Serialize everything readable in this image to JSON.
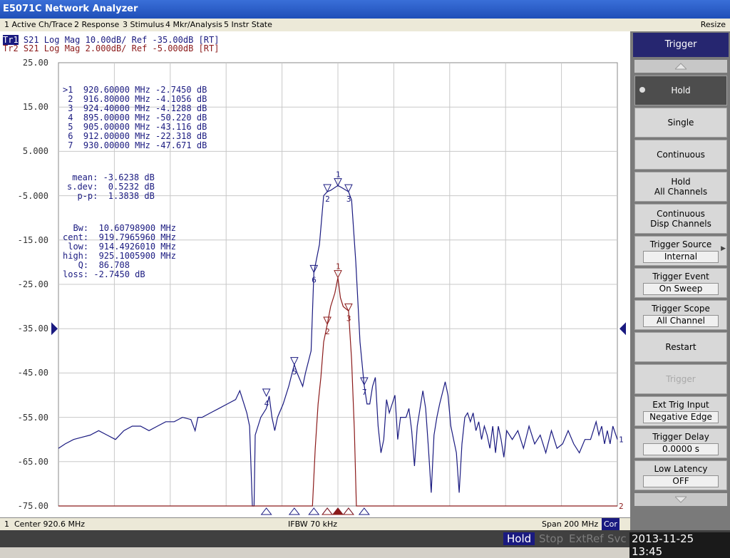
{
  "window": {
    "title": "E5071C Network Analyzer"
  },
  "menu": {
    "items": [
      "1 Active Ch/Trace",
      "2 Response",
      "3 Stimulus",
      "4 Mkr/Analysis",
      "5 Instr State"
    ],
    "resize": "Resize"
  },
  "traces": {
    "tr1": {
      "label": "Tr1",
      "text": " S21 Log Mag 10.00dB/ Ref -35.00dB [RT]"
    },
    "tr2": {
      "label": "Tr2",
      "text": " S21 Log Mag 2.000dB/ Ref -5.000dB [RT]"
    }
  },
  "marker_table": [
    ">1  920.60000 MHz -2.7450 dB",
    " 2  916.80000 MHz -4.1056 dB",
    " 3  924.40000 MHz -4.1288 dB",
    " 4  895.00000 MHz -50.220 dB",
    " 5  905.00000 MHz -43.116 dB",
    " 6  912.00000 MHz -22.318 dB",
    " 7  930.00000 MHz -47.671 dB"
  ],
  "stats": [
    " mean: -3.6238 dB",
    "s.dev:  0.5232 dB",
    "  p-p:  1.3838 dB"
  ],
  "bw_analysis": [
    "  Bw:  10.60798900 MHz",
    "cent:  919.7965960 MHz",
    " low:  914.4926010 MHz",
    "high:  925.1005900 MHz",
    "   Q:  86.708",
    "loss: -2.7450 dB"
  ],
  "chart_data": {
    "type": "line",
    "title": "",
    "xlabel": "",
    "ylabel": "",
    "x_unit": "MHz",
    "xlim": [
      820.6,
      1020.6
    ],
    "ylim": [
      -75,
      25
    ],
    "ytick_labels": [
      "25.00",
      "15.00",
      "5.000",
      "-5.000",
      "-15.00",
      "-25.00",
      "-35.00",
      "-45.00",
      "-55.00",
      "-65.00",
      "-75.00"
    ],
    "yticks": [
      25,
      15,
      5,
      -5,
      -15,
      -25,
      -35,
      -45,
      -55,
      -65,
      -75
    ],
    "grid": true,
    "reference_level": -35,
    "end_labels": [
      "1",
      "2"
    ],
    "series": [
      {
        "name": "Tr1",
        "color": "#1a1a80",
        "points": [
          [
            820.6,
            -62
          ],
          [
            823,
            -61
          ],
          [
            826,
            -60
          ],
          [
            829,
            -59.5
          ],
          [
            832,
            -59
          ],
          [
            835,
            -58
          ],
          [
            838,
            -59
          ],
          [
            841,
            -60
          ],
          [
            844,
            -58
          ],
          [
            847,
            -57
          ],
          [
            850,
            -57
          ],
          [
            853,
            -58
          ],
          [
            856,
            -57
          ],
          [
            859,
            -56
          ],
          [
            862,
            -56
          ],
          [
            865,
            -55
          ],
          [
            868,
            -55.5
          ],
          [
            869.5,
            -58
          ],
          [
            870.5,
            -55
          ],
          [
            872,
            -55
          ],
          [
            875,
            -54
          ],
          [
            878,
            -53
          ],
          [
            881,
            -52
          ],
          [
            884,
            -51
          ],
          [
            885.5,
            -49
          ],
          [
            887,
            -52
          ],
          [
            888,
            -54
          ],
          [
            889,
            -57
          ],
          [
            890,
            -75
          ],
          [
            890.6,
            -75
          ],
          [
            891,
            -59
          ],
          [
            893,
            -55
          ],
          [
            895,
            -53
          ],
          [
            896,
            -50.2
          ],
          [
            897,
            -55
          ],
          [
            898,
            -58
          ],
          [
            899,
            -55
          ],
          [
            901,
            -52
          ],
          [
            903,
            -48
          ],
          [
            905,
            -43.1
          ],
          [
            906,
            -45
          ],
          [
            908,
            -48
          ],
          [
            909,
            -45
          ],
          [
            911,
            -40
          ],
          [
            912,
            -22.3
          ],
          [
            914,
            -16
          ],
          [
            915.5,
            -5
          ],
          [
            916.8,
            -4.1
          ],
          [
            918,
            -3.8
          ],
          [
            920.6,
            -2.7
          ],
          [
            922,
            -3.2
          ],
          [
            924.4,
            -4.1
          ],
          [
            925.5,
            -6
          ],
          [
            927,
            -20
          ],
          [
            928.5,
            -38
          ],
          [
            930,
            -47.7
          ],
          [
            931,
            -52
          ],
          [
            932,
            -52
          ],
          [
            933,
            -48
          ],
          [
            934,
            -46
          ],
          [
            935,
            -57
          ],
          [
            936,
            -63
          ],
          [
            937,
            -60
          ],
          [
            938,
            -51
          ],
          [
            939,
            -54
          ],
          [
            941,
            -50
          ],
          [
            942,
            -60
          ],
          [
            943,
            -55
          ],
          [
            945,
            -55
          ],
          [
            946,
            -53
          ],
          [
            947,
            -58
          ],
          [
            948,
            -66
          ],
          [
            949,
            -57
          ],
          [
            950,
            -53
          ],
          [
            951,
            -49
          ],
          [
            952,
            -53
          ],
          [
            953,
            -62
          ],
          [
            954,
            -72
          ],
          [
            955,
            -59
          ],
          [
            956,
            -55
          ],
          [
            957,
            -52
          ],
          [
            959,
            -47
          ],
          [
            960,
            -50
          ],
          [
            961,
            -57
          ],
          [
            962,
            -60
          ],
          [
            963,
            -63
          ],
          [
            964,
            -72
          ],
          [
            965,
            -61
          ],
          [
            966,
            -55
          ],
          [
            967,
            -54
          ],
          [
            968,
            -56
          ],
          [
            969,
            -54
          ],
          [
            970,
            -58
          ],
          [
            971,
            -56
          ],
          [
            972,
            -60
          ],
          [
            973,
            -57
          ],
          [
            974,
            -59
          ],
          [
            975,
            -62
          ],
          [
            976,
            -57
          ],
          [
            977,
            -63
          ],
          [
            978,
            -57
          ],
          [
            979,
            -60
          ],
          [
            980,
            -64
          ],
          [
            981,
            -58
          ],
          [
            983,
            -60
          ],
          [
            985,
            -58
          ],
          [
            987,
            -62
          ],
          [
            989,
            -57
          ],
          [
            991,
            -61
          ],
          [
            993,
            -59
          ],
          [
            995,
            -63
          ],
          [
            997,
            -58
          ],
          [
            999,
            -62
          ],
          [
            1001,
            -61
          ],
          [
            1003,
            -58
          ],
          [
            1005,
            -61
          ],
          [
            1007,
            -63
          ],
          [
            1009,
            -60
          ],
          [
            1011,
            -60
          ],
          [
            1012,
            -58
          ],
          [
            1013,
            -56
          ],
          [
            1014,
            -59
          ],
          [
            1015,
            -57
          ],
          [
            1016,
            -61
          ],
          [
            1017,
            -58
          ],
          [
            1018,
            -61
          ],
          [
            1019,
            -57
          ],
          [
            1020.6,
            -60
          ]
        ]
      },
      {
        "name": "Tr2",
        "color": "#8b1a1a",
        "points": [
          [
            820.6,
            -75
          ],
          [
            911.5,
            -75
          ],
          [
            912.5,
            -62
          ],
          [
            913.5,
            -52
          ],
          [
            914.5,
            -46
          ],
          [
            915.5,
            -38
          ],
          [
            916.8,
            -34
          ],
          [
            918,
            -30
          ],
          [
            919.5,
            -27
          ],
          [
            920.6,
            -23.5
          ],
          [
            921.5,
            -28
          ],
          [
            922.5,
            -30
          ],
          [
            924.4,
            -31
          ],
          [
            925.5,
            -42
          ],
          [
            926.5,
            -58
          ],
          [
            927.2,
            -75
          ],
          [
            1020.6,
            -75
          ]
        ]
      }
    ],
    "markers": [
      {
        "series": "Tr1",
        "label": "1",
        "x": 920.6,
        "y": -2.745
      },
      {
        "series": "Tr1",
        "label": "2",
        "x": 916.8,
        "y": -4.1056
      },
      {
        "series": "Tr1",
        "label": "3",
        "x": 924.4,
        "y": -4.1288
      },
      {
        "series": "Tr1",
        "label": "4",
        "x": 895.0,
        "y": -50.22
      },
      {
        "series": "Tr1",
        "label": "5",
        "x": 905.0,
        "y": -43.116
      },
      {
        "series": "Tr1",
        "label": "6",
        "x": 912.0,
        "y": -22.318
      },
      {
        "series": "Tr1",
        "label": "7",
        "x": 930.0,
        "y": -47.671
      },
      {
        "series": "Tr2",
        "label": "1",
        "x": 920.6,
        "y": -23.5
      },
      {
        "series": "Tr2",
        "label": "2",
        "x": 916.8,
        "y": -34
      },
      {
        "series": "Tr2",
        "label": "3",
        "x": 924.4,
        "y": -31
      }
    ]
  },
  "status": {
    "channel": "1",
    "center": "Center 920.6 MHz",
    "ifbw": "IFBW 70 kHz",
    "span": "Span 200 MHz",
    "cor": "Cor"
  },
  "bottom": {
    "hold": "Hold",
    "stop": "Stop",
    "extref": "ExtRef",
    "svc": "Svc",
    "datetime": "2013-11-25 13:45"
  },
  "softkeys": {
    "title": "Trigger",
    "items": [
      {
        "label": "Hold",
        "active": true
      },
      {
        "label": "Single"
      },
      {
        "label": "Continuous"
      },
      {
        "label": "Hold",
        "label2": "All Channels"
      },
      {
        "label": "Continuous",
        "label2": "Disp Channels"
      },
      {
        "label": "Trigger Source",
        "value": "Internal"
      },
      {
        "label": "Trigger Event",
        "value": "On Sweep"
      },
      {
        "label": "Trigger Scope",
        "value": "All Channel"
      },
      {
        "label": "Restart"
      },
      {
        "label": "Trigger",
        "disabled": true
      },
      {
        "label": "Ext Trig Input",
        "value": "Negative Edge"
      },
      {
        "label": "Trigger Delay",
        "value": "0.0000 s"
      },
      {
        "label": "Low Latency",
        "value": "OFF"
      }
    ]
  }
}
